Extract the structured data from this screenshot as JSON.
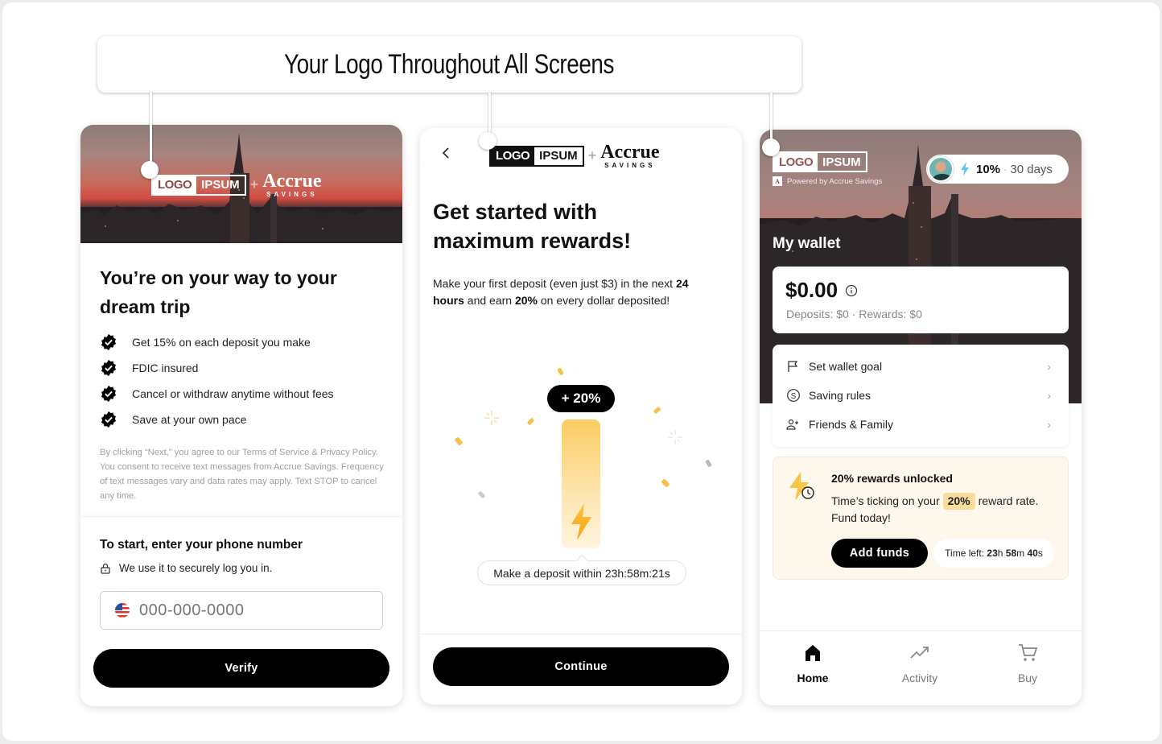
{
  "banner": {
    "title": "Your Logo Throughout All Screens"
  },
  "brand": {
    "logo_part1": "LOGO",
    "logo_part2": "IPSUM",
    "plus": "+",
    "partner_name": "Accrue",
    "partner_sub": "SAVINGS",
    "accent_color": "#fbcc62"
  },
  "screen1": {
    "title": "You’re on your way to your dream trip",
    "benefits": [
      "Get 15% on each deposit you make",
      "FDIC insured",
      "Cancel or withdraw anytime without fees",
      "Save at your own pace"
    ],
    "legal": "By clicking “Next,” you agree to our Terms of Service & Privacy Policy. You consent to receive text messages from Accrue Savings. Frequency of text messages vary and data rates may apply. Text STOP to cancel any time.",
    "phone_heading": "To start, enter your phone number",
    "secure_note": "We use it to securely log you in.",
    "phone_placeholder": "000-000-0000",
    "phone_value": "",
    "verify_label": "Verify"
  },
  "screen2": {
    "back_icon": "chevron-left-icon",
    "title_line1": "Get started with",
    "title_line2": "maximum rewards!",
    "desc_part1": "Make your first deposit (even just $3) in the next ",
    "desc_bold1": "24 hours",
    "desc_part2": " and earn ",
    "desc_bold2": "20%",
    "desc_part3": " on every dollar deposited!",
    "reward_badge": "+ 20%",
    "timer_text": "Make a deposit within 23h:58m:21s",
    "continue_label": "Continue"
  },
  "screen3": {
    "powered_by": "Powered by Accrue Savings",
    "powered_icon_letter": "A",
    "reward_rate": "10%",
    "reward_sep": "·",
    "reward_days": "30 days",
    "wallet_title": "My wallet",
    "balance": "$0.00",
    "balance_sub": "Deposits: $0 · Rewards: $0",
    "menu": [
      {
        "label": "Set wallet goal",
        "icon": "flag-icon"
      },
      {
        "label": "Saving rules",
        "icon": "dollar-circle-icon"
      },
      {
        "label": "Friends & Family",
        "icon": "add-people-icon"
      }
    ],
    "promo": {
      "title": "20% rewards unlocked",
      "text_before": "Time’s ticking on your",
      "pct": "20%",
      "text_after": "reward rate. Fund today!",
      "add_funds_label": "Add funds",
      "time_left_label": "Time left:",
      "time_h": "23",
      "time_h_unit": "h",
      "time_m": "58",
      "time_m_unit": "m",
      "time_s": "40",
      "time_s_unit": "s"
    },
    "tabs": [
      {
        "label": "Home",
        "icon": "home-icon",
        "active": true
      },
      {
        "label": "Activity",
        "icon": "trending-up-icon",
        "active": false
      },
      {
        "label": "Buy",
        "icon": "cart-icon",
        "active": false
      }
    ]
  }
}
